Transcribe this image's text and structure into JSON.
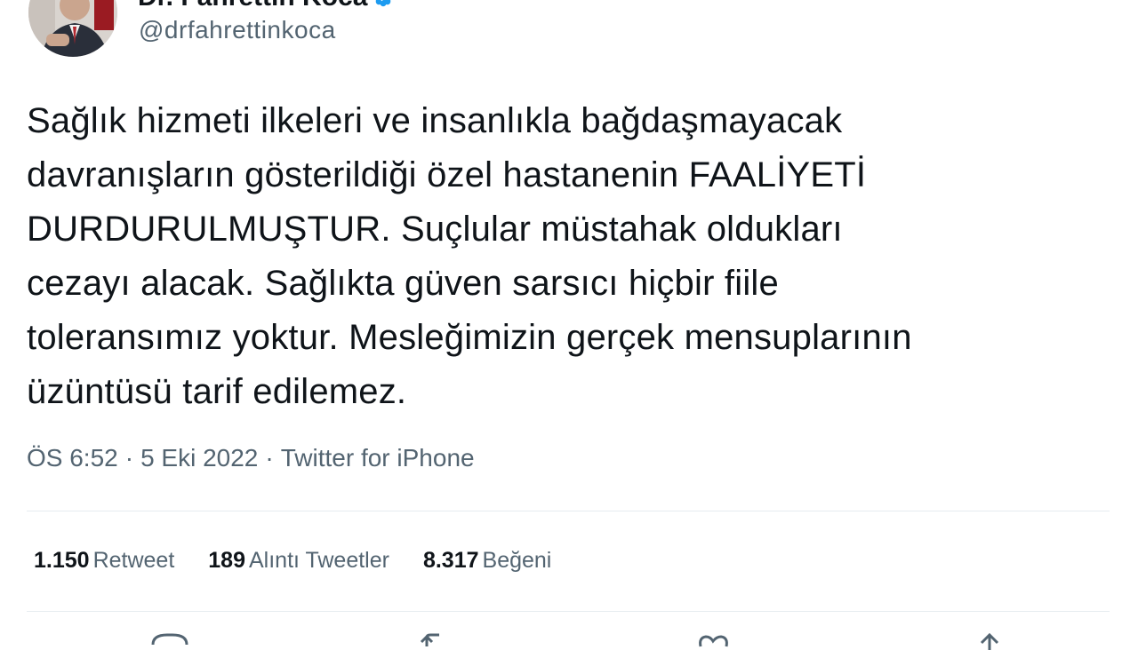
{
  "user": {
    "display_name": "Dr. Fahrettin Koca",
    "handle": "@drfahrettinkoca",
    "verified_icon": "verified-badge-icon",
    "colors": {
      "verified": "#1d9bf0"
    }
  },
  "tweet": {
    "text": "Sağlık hizmeti ilkeleri ve insanlıkla bağdaşmayacak\ndavranışların gösterildiği özel hastanenin FAALİYETİ\nDURDURULMUŞTUR. Suçlular müstahak oldukları\ncezayı alacak. Sağlıkta güven sarsıcı hiçbir fiile\ntoleransımız yoktur. Mesleğimizin gerçek mensuplarının\nüzüntüsü tarif edilemez."
  },
  "meta": {
    "time": "ÖS 6:52",
    "date": "5 Eki 2022",
    "source": "Twitter for iPhone",
    "separator": "·"
  },
  "stats": {
    "retweets": {
      "count": "1.150",
      "label": "Retweet"
    },
    "quotes": {
      "count": "189",
      "label": "Alıntı Tweetler"
    },
    "likes": {
      "count": "8.317",
      "label": "Beğeni"
    }
  },
  "actions": {
    "icons": [
      "reply-icon",
      "retweet-icon",
      "like-icon",
      "share-icon"
    ]
  }
}
